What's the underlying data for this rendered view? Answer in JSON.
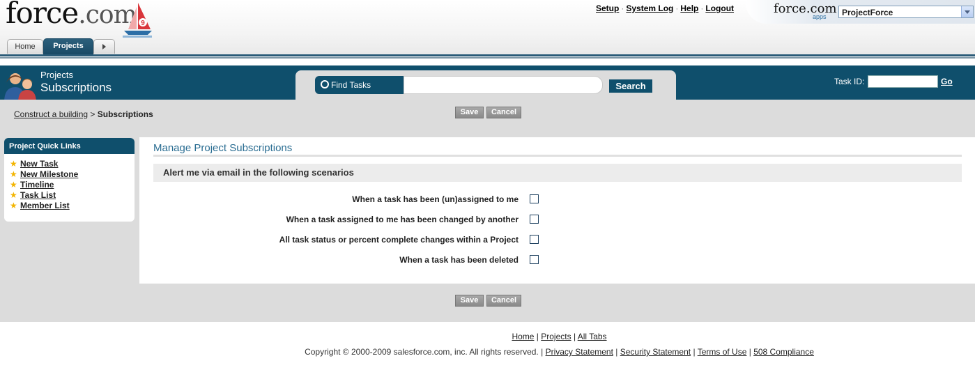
{
  "brand": {
    "logo_main": "force",
    "logo_dotcom": ".com",
    "sail_number": "9"
  },
  "tabs": [
    {
      "label": "Home"
    },
    {
      "label": "Projects"
    }
  ],
  "top_links": [
    "Setup",
    "System Log",
    "Help",
    "Logout"
  ],
  "apps": {
    "logo": "force.com",
    "logo_sub": "apps",
    "selected_app": "ProjectForce"
  },
  "header": {
    "section_small": "Projects",
    "section_big": "Subscriptions"
  },
  "search": {
    "label": "Find Tasks",
    "value": "",
    "button": "Search"
  },
  "task_id": {
    "label": "Task ID:",
    "value": "",
    "go_label": "Go"
  },
  "breadcrumb": {
    "link": "Construct a building",
    "separator": " > ",
    "current": "Subscriptions"
  },
  "buttons": {
    "save": "Save",
    "cancel": "Cancel"
  },
  "sidebar": {
    "title": "Project Quick Links",
    "items": [
      "New Task",
      "New Milestone",
      "Timeline",
      "Task List",
      "Member List"
    ]
  },
  "main": {
    "title": "Manage Project Subscriptions",
    "section": "Alert me via email in the following scenarios",
    "options": [
      {
        "label": "When a task has been (un)assigned to me",
        "checked": false
      },
      {
        "label": "When a task assigned to me has been changed by another",
        "checked": false
      },
      {
        "label": "All task status or percent complete changes within a Project",
        "checked": false
      },
      {
        "label": "When a task has been deleted",
        "checked": false
      }
    ]
  },
  "footer": {
    "links": [
      "Home",
      "Projects",
      "All Tabs"
    ],
    "copyright": "Copyright © 2000-2009 salesforce.com, inc. All rights reserved. |",
    "legal_links": [
      "Privacy Statement",
      "Security Statement",
      "Terms of Use",
      "508 Compliance"
    ]
  },
  "colors": {
    "brand_dark": "#0f4f6c",
    "heading": "#2a6d92",
    "page_grey": "#dcdcdc"
  }
}
